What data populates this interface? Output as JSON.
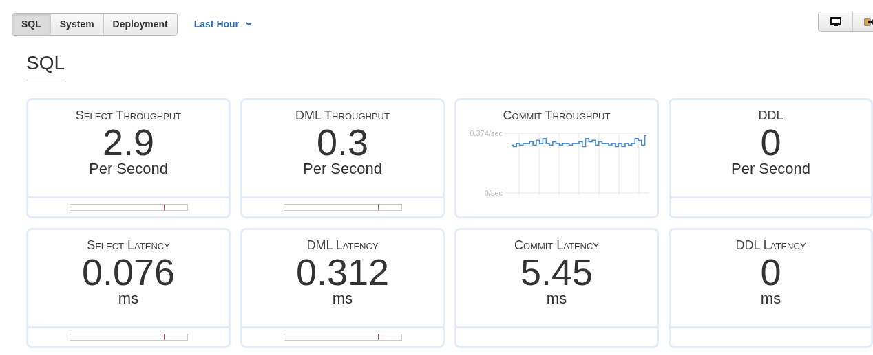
{
  "tabs": [
    {
      "label": "SQL",
      "selected": true
    },
    {
      "label": "System",
      "selected": false
    },
    {
      "label": "Deployment",
      "selected": false
    }
  ],
  "time_range": {
    "label": "Last Hour"
  },
  "toolbar": [
    {
      "kind": "monitor"
    },
    {
      "kind": "exit"
    }
  ],
  "section_title": "SQL",
  "cards": [
    {
      "kind": "stat",
      "title": "Select Throughput",
      "value": "2.9",
      "unit": "Per Second",
      "range_bar": {
        "level": 0.8
      }
    },
    {
      "kind": "stat",
      "title": "DML Throughput",
      "value": "0.3",
      "unit": "Per Second",
      "range_bar": {
        "level": 0.8
      }
    },
    {
      "kind": "chart",
      "title": "Commit Throughput",
      "chart_data": {
        "type": "line",
        "yticks": [
          {
            "value": 0,
            "label": "0/sec"
          },
          {
            "value": 0.374,
            "label": "0.374/sec"
          }
        ],
        "ylim": [
          0,
          0.374
        ],
        "series": [
          {
            "color": "#4a90d9",
            "values": [
              0.3,
              0.29,
              0.31,
              0.3,
              0.31,
              0.31,
              0.32,
              0.3,
              0.33,
              0.31,
              0.34,
              0.31,
              0.3,
              0.32,
              0.31,
              0.3,
              0.31,
              0.31,
              0.3,
              0.31,
              0.31,
              0.32,
              0.29,
              0.34,
              0.32,
              0.33,
              0.3,
              0.32,
              0.31,
              0.31,
              0.3,
              0.31,
              0.29,
              0.31,
              0.29,
              0.31,
              0.3,
              0.31,
              0.34,
              0.33,
              0.3,
              0.36
            ]
          }
        ]
      }
    },
    {
      "kind": "stat",
      "title": "DDL",
      "value": "0",
      "unit": "Per Second"
    },
    {
      "kind": "stat",
      "title": "Select Latency",
      "value": "0.076",
      "unit": "ms",
      "range_bar": {
        "level": 0.8
      }
    },
    {
      "kind": "stat",
      "title": "DML Latency",
      "value": "0.312",
      "unit": "ms",
      "range_bar": {
        "level": 0.8
      }
    },
    {
      "kind": "stat",
      "title": "Commit Latency",
      "value": "5.45",
      "unit": "ms"
    },
    {
      "kind": "stat",
      "title": "DDL Latency",
      "value": "0",
      "unit": "ms"
    }
  ]
}
